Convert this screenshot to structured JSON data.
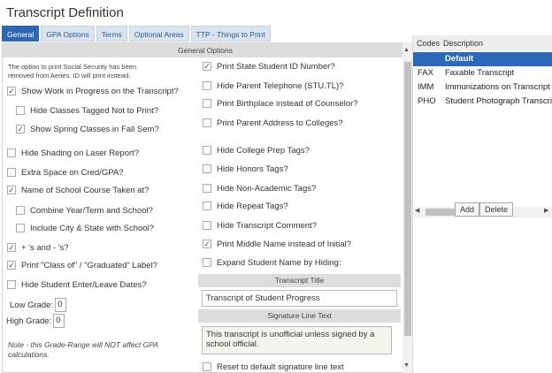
{
  "title": "Transcript Definition",
  "tabs": [
    "General",
    "GPA Options",
    "Terms",
    "Optional Areas",
    "TTP - Things to Print"
  ],
  "general_header": "General Options",
  "ssn_note_1": "The option to print Social Security has been",
  "ssn_note_2": "removed from Aeries. ID will print instead.",
  "left_options": [
    {
      "label": "Show Work in Progress on the Transcript?",
      "checked": true
    },
    {
      "label": "Hide Classes Tagged Not to Print?",
      "checked": false
    },
    {
      "label": "Show Spring Classes in Fall Sem?",
      "checked": true
    },
    {
      "label": "Hide Shading on Laser Report?",
      "checked": false
    },
    {
      "label": "Extra Space on Cred/GPA?",
      "checked": false
    },
    {
      "label": "Name of School Course Taken at?",
      "checked": true
    },
    {
      "label": "Combine Year/Term and School?",
      "checked": false
    },
    {
      "label": "Include City & State with School?",
      "checked": false
    },
    {
      "label": "+ 's and - 's?",
      "checked": true
    },
    {
      "label": "Print \"Class of\" / \"Graduated\" Label?",
      "checked": true
    },
    {
      "label": "Hide Student Enter/Leave Dates?",
      "checked": false
    }
  ],
  "low_grade_label": "Low Grade:",
  "low_grade": "0",
  "high_grade_label": "High Grade:",
  "high_grade": "0",
  "grade_note_1": "Note - this Grade-Range will NOT affect GPA",
  "grade_note_2": "calculations.",
  "right_options": [
    {
      "label": "Print State Student ID Number?",
      "checked": true
    },
    {
      "label": "Hide Parent Telephone (STU.TL)?",
      "checked": false
    },
    {
      "label": "Print Birthplace instead of Counselor?",
      "checked": false
    },
    {
      "label": "Print Parent Address to Colleges?",
      "checked": false
    },
    {
      "label": "Hide College Prep Tags?",
      "checked": false
    },
    {
      "label": "Hide Honors Tags?",
      "checked": false
    },
    {
      "label": "Hide Non-Academic Tags?",
      "checked": false
    },
    {
      "label": "Hide Repeat Tags?",
      "checked": false
    },
    {
      "label": "Hide Transcript Comment?",
      "checked": false
    },
    {
      "label": "Print Middle Name instead of Initial?",
      "checked": true
    },
    {
      "label": "Expand Student Name by Hiding:",
      "checked": false
    }
  ],
  "transcript_title_header": "Transcript Title",
  "transcript_title": "Transcript of Student Progress",
  "signature_header": "Signature Line Text",
  "signature_text": "This transcript is unofficial unless signed by a school official.",
  "reset_label": "Reset to default signature line text",
  "codes_table": {
    "headers": [
      "Codes",
      "Description"
    ],
    "rows": [
      {
        "code": "",
        "desc": "Default",
        "selected": true
      },
      {
        "code": "FAX",
        "desc": "Faxable Transcript"
      },
      {
        "code": "IMM",
        "desc": "Immunizations on Transcript"
      },
      {
        "code": "PHO",
        "desc": "Student Photograph Transcript"
      }
    ],
    "add_label": "Add",
    "delete_label": "Delete"
  },
  "colors": {
    "tab_active": "#2f67b2",
    "selected_row": "#2a6ab8"
  }
}
